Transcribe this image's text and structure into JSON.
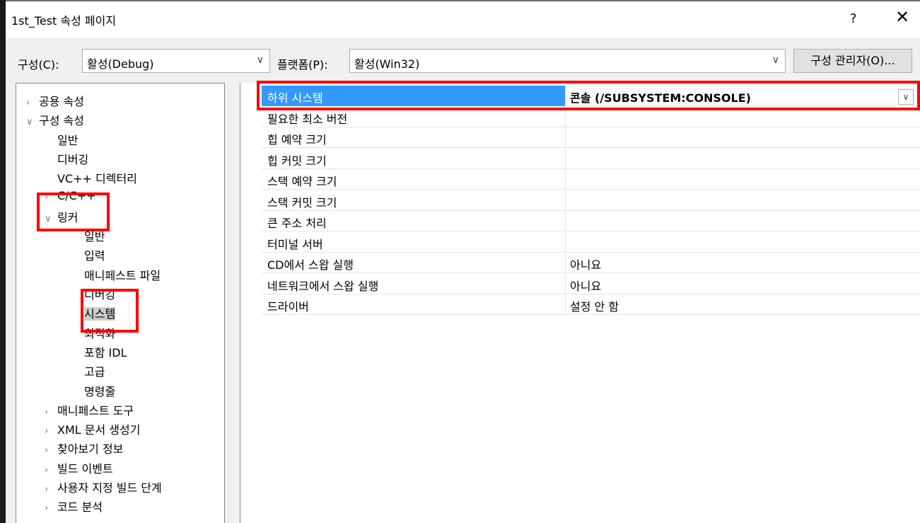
{
  "window": {
    "title": "1st_Test 속성 페이지",
    "help_label": "?",
    "close_label": "✕"
  },
  "toolbar": {
    "config_label": "구성(C):",
    "config_value": "활성(Debug)",
    "platform_label": "플랫폼(P):",
    "platform_value": "활성(Win32)",
    "config_manager_label": "구성 관리자(O)...",
    "dropdown_arrow": "∨"
  },
  "tree": [
    {
      "label": "공용 속성",
      "chevron": "›"
    },
    {
      "label": "구성 속성",
      "chevron": "∨"
    },
    {
      "label": "일반",
      "chevron": ""
    },
    {
      "label": "디버깅",
      "chevron": ""
    },
    {
      "label": "VC++ 디렉터리",
      "chevron": ""
    },
    {
      "label": "C/C++",
      "chevron": "›"
    },
    {
      "label": "링커",
      "chevron": "∨"
    },
    {
      "label": "일반",
      "chevron": ""
    },
    {
      "label": "입력",
      "chevron": ""
    },
    {
      "label": "매니페스트 파일",
      "chevron": ""
    },
    {
      "label": "디버깅",
      "chevron": ""
    },
    {
      "label": "시스템",
      "chevron": ""
    },
    {
      "label": "최적화",
      "chevron": ""
    },
    {
      "label": "포함 IDL",
      "chevron": ""
    },
    {
      "label": "고급",
      "chevron": ""
    },
    {
      "label": "명령줄",
      "chevron": ""
    },
    {
      "label": "매니페스트 도구",
      "chevron": "›"
    },
    {
      "label": "XML 문서 생성기",
      "chevron": "›"
    },
    {
      "label": "찾아보기 정보",
      "chevron": "›"
    },
    {
      "label": "빌드 이벤트",
      "chevron": "›"
    },
    {
      "label": "사용자 지정 빌드 단계",
      "chevron": "›"
    },
    {
      "label": "코드 분석",
      "chevron": "›"
    }
  ],
  "properties": [
    {
      "name": "하위 시스템",
      "value": "콘솔 (/SUBSYSTEM:CONSOLE)"
    },
    {
      "name": "필요한 최소 버전",
      "value": ""
    },
    {
      "name": "힙 예약 크기",
      "value": ""
    },
    {
      "name": "힙 커밋 크기",
      "value": ""
    },
    {
      "name": "스택 예약 크기",
      "value": ""
    },
    {
      "name": "스택 커밋 크기",
      "value": ""
    },
    {
      "name": "큰 주소 처리",
      "value": ""
    },
    {
      "name": "터미널 서버",
      "value": ""
    },
    {
      "name": "CD에서 스왑 실행",
      "value": "아니요"
    },
    {
      "name": "네트워크에서 스왑 실행",
      "value": "아니요"
    },
    {
      "name": "드라이버",
      "value": "설정 안 함"
    }
  ],
  "colors": {
    "highlight": "#ff0000",
    "selection": "#3399ff"
  }
}
